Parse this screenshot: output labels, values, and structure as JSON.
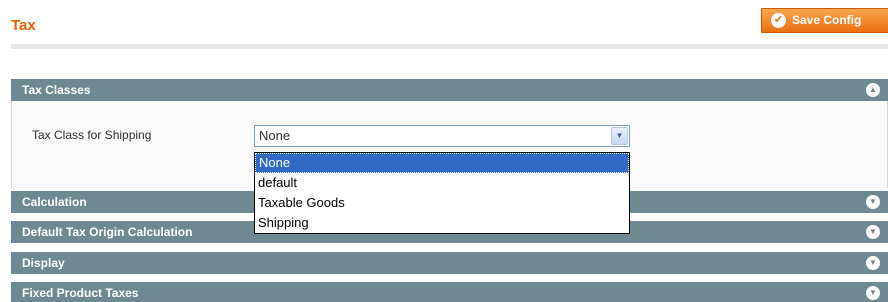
{
  "header": {
    "title": "Tax",
    "save_label": "Save Config"
  },
  "sections": [
    {
      "title": "Tax Classes",
      "state": "expanded"
    },
    {
      "title": "Calculation",
      "state": "collapsed"
    },
    {
      "title": "Default Tax Origin Calculation",
      "state": "collapsed"
    },
    {
      "title": "Display",
      "state": "collapsed"
    },
    {
      "title": "Fixed Product Taxes",
      "state": "collapsed"
    }
  ],
  "tax_classes": {
    "field_label": "Tax Class for Shipping",
    "selected_value": "None",
    "options": [
      "None",
      "default",
      "Taxable Goods",
      "Shipping"
    ]
  },
  "colors": {
    "title": "#eb5e00",
    "section_header": "#6f8992",
    "button": "#eb6e12",
    "selection": "#316ac5"
  },
  "icons": {
    "save": "check-circle-icon",
    "expanded": "collapse-up-icon",
    "collapsed": "expand-down-icon",
    "select": "chevron-down-icon"
  }
}
